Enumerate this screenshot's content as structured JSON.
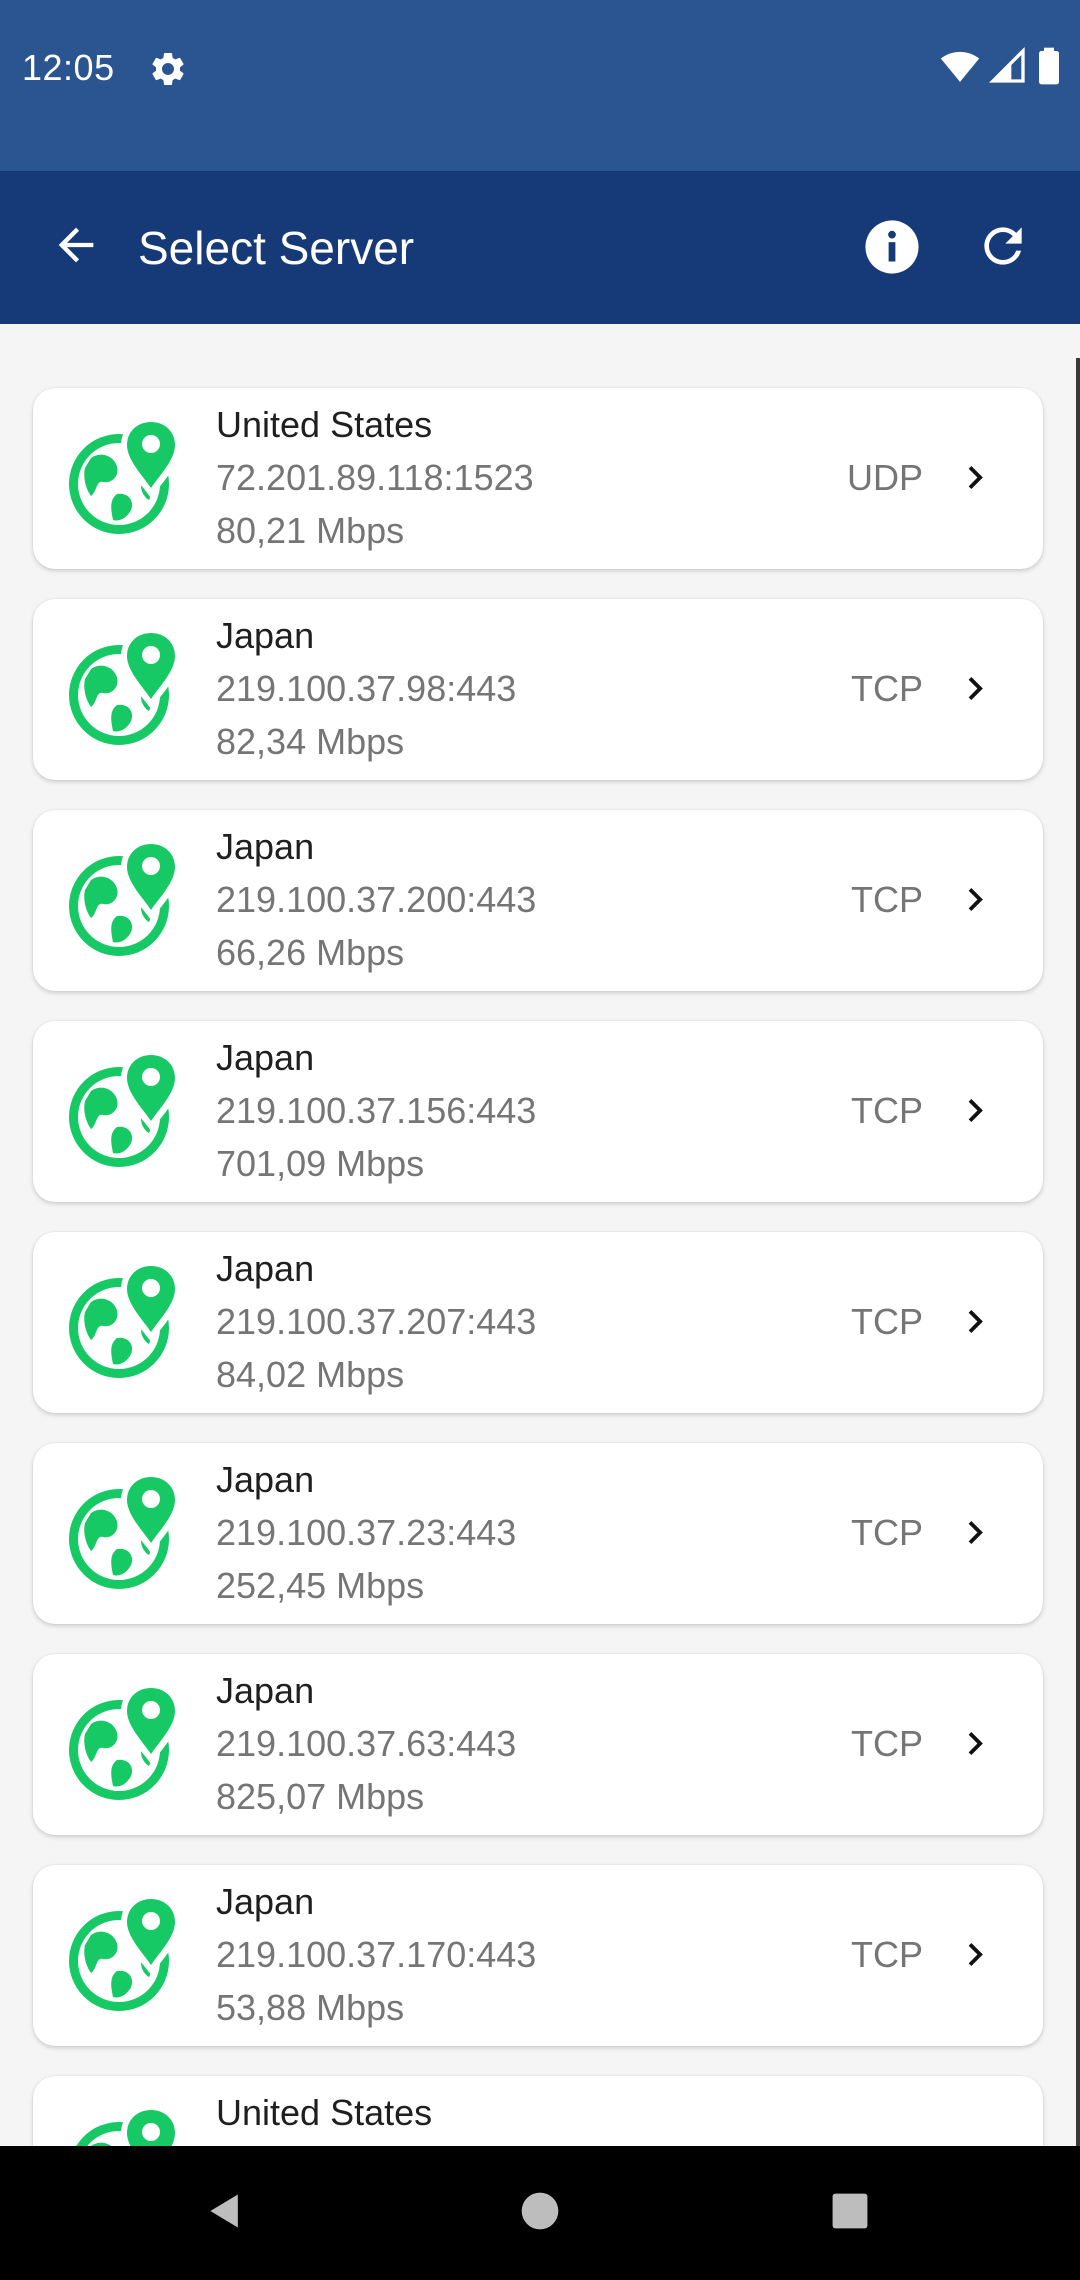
{
  "status_bar": {
    "time": "12:05",
    "icons": [
      "gear-icon",
      "wifi-icon",
      "cell-signal-icon",
      "battery-icon"
    ]
  },
  "app_bar": {
    "title": "Select Server",
    "actions": [
      "back-arrow-icon",
      "info-icon",
      "refresh-icon"
    ]
  },
  "colors": {
    "status_bar": "#2b5591",
    "app_bar": "#163a78",
    "globe_accent": "#17c964",
    "background": "#f5f5f5"
  },
  "servers": [
    {
      "country": "United States",
      "address": "72.201.89.118:1523",
      "speed": "80,21 Mbps",
      "protocol": "UDP"
    },
    {
      "country": "Japan",
      "address": "219.100.37.98:443",
      "speed": "82,34 Mbps",
      "protocol": "TCP"
    },
    {
      "country": "Japan",
      "address": "219.100.37.200:443",
      "speed": "66,26 Mbps",
      "protocol": "TCP"
    },
    {
      "country": "Japan",
      "address": "219.100.37.156:443",
      "speed": "701,09 Mbps",
      "protocol": "TCP"
    },
    {
      "country": "Japan",
      "address": "219.100.37.207:443",
      "speed": "84,02 Mbps",
      "protocol": "TCP"
    },
    {
      "country": "Japan",
      "address": "219.100.37.23:443",
      "speed": "252,45 Mbps",
      "protocol": "TCP"
    },
    {
      "country": "Japan",
      "address": "219.100.37.63:443",
      "speed": "825,07 Mbps",
      "protocol": "TCP"
    },
    {
      "country": "Japan",
      "address": "219.100.37.170:443",
      "speed": "53,88 Mbps",
      "protocol": "TCP"
    },
    {
      "country": "United States",
      "address": "",
      "speed": "",
      "protocol": ""
    }
  ],
  "nav_bar": {
    "buttons": [
      "back-triangle-icon",
      "home-circle-icon",
      "recents-square-icon"
    ]
  }
}
